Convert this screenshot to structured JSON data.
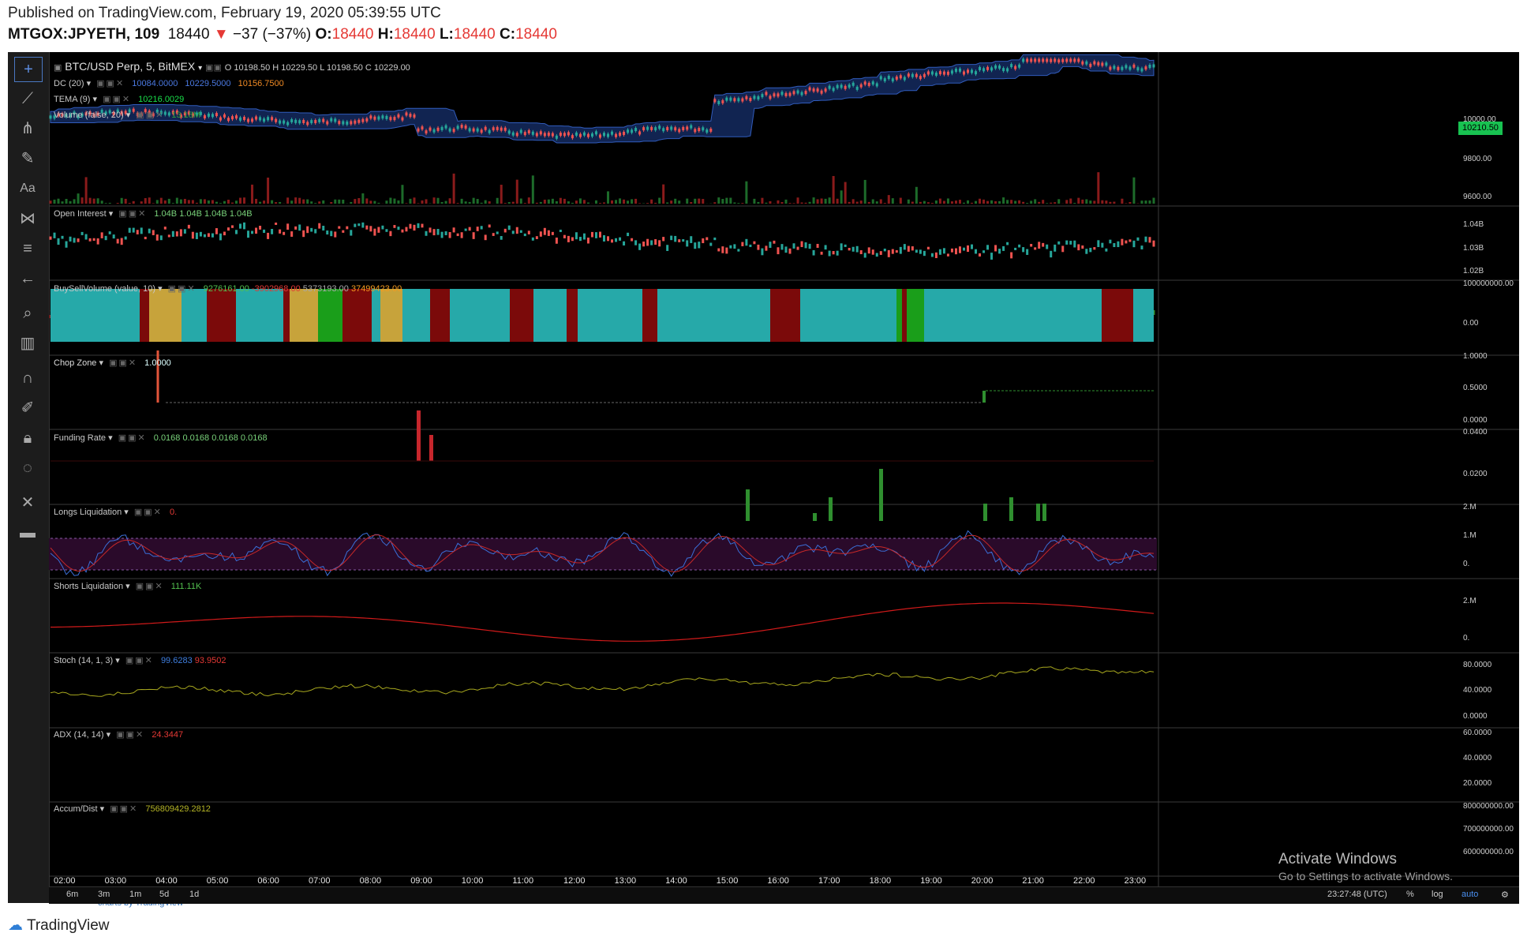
{
  "header": {
    "published": "Published on TradingView.com, February 19, 2020 05:39:55 UTC",
    "symbol": "MTGOX:JPYETH, 109",
    "price": "18440",
    "change": "−37 (−37%)",
    "o_label": "O:",
    "o": "18440",
    "h_label": "H:",
    "h": "18440",
    "l_label": "L:",
    "l": "18440",
    "c_label": "C:",
    "c": "18440"
  },
  "main": {
    "title": "BTC/USD Perp, 5, BitMEX",
    "ohlc": "O 10198.50  H 10229.50  L 10198.50  C 10229.00",
    "price_badge": "10210.50",
    "indicators": [
      {
        "name": "DC (20)",
        "values": [
          "10084.0000",
          "10229.5000",
          "10156.7500"
        ]
      },
      {
        "name": "TEMA (9)",
        "values": [
          "10216.0029"
        ]
      },
      {
        "name": "Volume (false, 20)",
        "values": [
          "13.18M"
        ]
      }
    ],
    "axis": [
      "10000.00",
      "9800.00",
      "9600.00"
    ]
  },
  "panes": [
    {
      "id": "oi",
      "name": "Open Interest",
      "values": [
        "1.04B",
        "1.04B",
        "1.04B",
        "1.04B"
      ],
      "axis": [
        "1.04B",
        "1.03B",
        "1.02B"
      ]
    },
    {
      "id": "bsv",
      "name": "BuySellVolume (value, 10)",
      "values": [
        "9276161.00",
        "-3902968.00",
        "5373193.00",
        "37499423.00"
      ],
      "axis": [
        "100000000.00",
        "0.00"
      ]
    },
    {
      "id": "chop",
      "name": "Chop Zone",
      "values": [
        "1.0000"
      ],
      "axis": [
        "1.0000",
        "0.5000",
        "0.0000"
      ]
    },
    {
      "id": "fund",
      "name": "Funding Rate",
      "values": [
        "0.0168",
        "0.0168",
        "0.0168",
        "0.0168"
      ],
      "axis": [
        "0.0400",
        "0.0200"
      ]
    },
    {
      "id": "longs",
      "name": "Longs Liquidation",
      "values": [
        "0."
      ],
      "axis": [
        "2.M",
        "1.M",
        "0."
      ]
    },
    {
      "id": "shorts",
      "name": "Shorts Liquidation",
      "values": [
        "111.11K"
      ],
      "axis": [
        "2.M",
        "0."
      ]
    },
    {
      "id": "stoch",
      "name": "Stoch (14, 1, 3)",
      "values": [
        "99.6283",
        "93.9502"
      ],
      "axis": [
        "80.0000",
        "40.0000",
        "0.0000"
      ]
    },
    {
      "id": "adx",
      "name": "ADX (14, 14)",
      "values": [
        "24.3447"
      ],
      "axis": [
        "60.0000",
        "40.0000",
        "20.0000"
      ]
    },
    {
      "id": "ad",
      "name": "Accum/Dist",
      "values": [
        "756809429.2812"
      ],
      "axis": [
        "800000000.00",
        "700000000.00",
        "600000000.00"
      ]
    }
  ],
  "time_axis": [
    "02:00",
    "03:00",
    "04:00",
    "05:00",
    "06:00",
    "07:00",
    "08:00",
    "09:00",
    "10:00",
    "11:00",
    "12:00",
    "13:00",
    "14:00",
    "15:00",
    "16:00",
    "17:00",
    "18:00",
    "19:00",
    "20:00",
    "21:00",
    "22:00",
    "23:00"
  ],
  "bottom_bar": {
    "timeframes": [
      "6m",
      "3m",
      "1m",
      "5d",
      "1d"
    ],
    "clock": "23:27:48 (UTC)",
    "pct": "%",
    "log": "log",
    "auto": "auto"
  },
  "watermark": {
    "line1": "Activate Windows",
    "line2": "Go to Settings to activate Windows."
  },
  "chart_brand": "charts by TradingView",
  "footer": "TradingView",
  "colors": {
    "up": "#26a69a",
    "down": "#ef5350",
    "dc_band": "#1e3a7a",
    "chop_cyan": "#26a9a9",
    "chop_red": "#7b0a0a",
    "stoch_bg": "#2a0a2a"
  }
}
